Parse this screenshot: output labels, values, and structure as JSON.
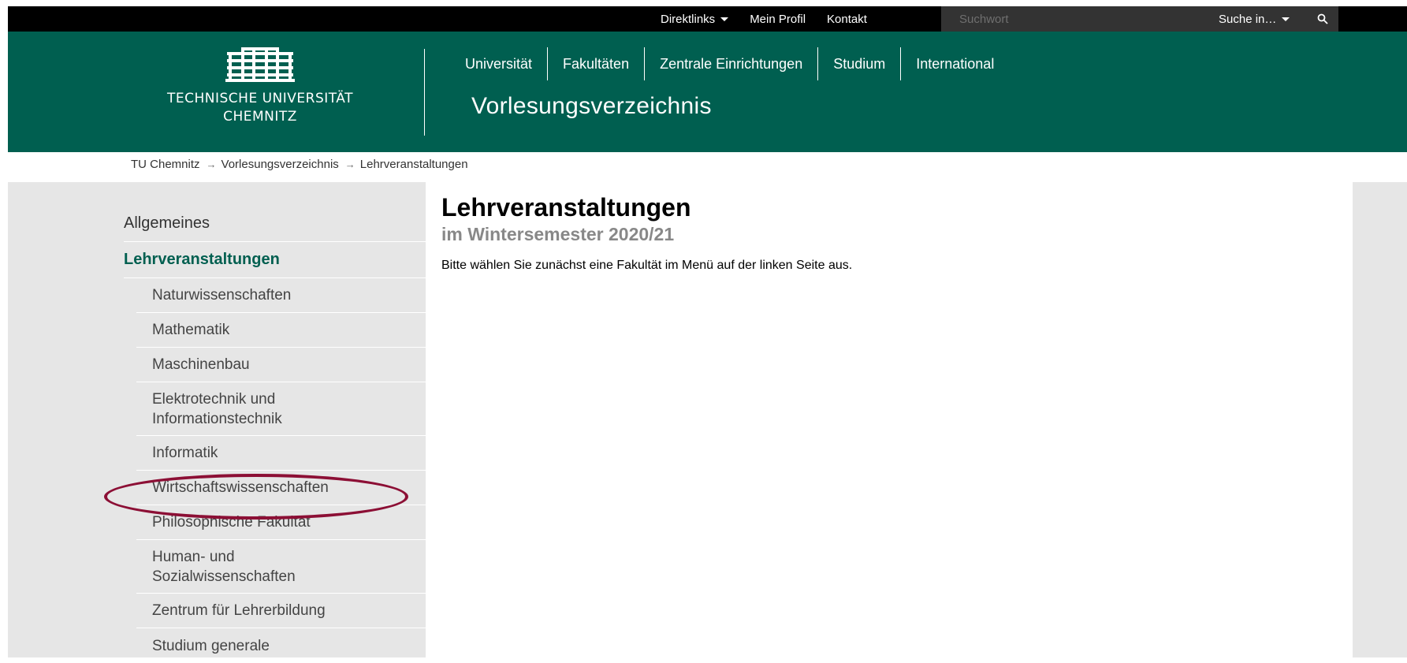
{
  "topbar": {
    "direktlinks": "Direktlinks",
    "profile": "Mein Profil",
    "contact": "Kontakt",
    "search_placeholder": "Suchwort",
    "search_in": "Suche in…"
  },
  "header": {
    "logo_line1": "TECHNISCHE UNIVERSITÄT",
    "logo_line2": "CHEMNITZ",
    "nav": [
      "Universität",
      "Fakultäten",
      "Zentrale Einrichtungen",
      "Studium",
      "International"
    ],
    "site_title": "Vorlesungsverzeichnis"
  },
  "breadcrumb": [
    "TU Chemnitz",
    "Vorlesungsverzeichnis",
    "Lehrveranstaltungen"
  ],
  "breadcrumb_sep": "→",
  "sidebar": {
    "general": "Allgemeines",
    "active": "Lehrveranstaltungen",
    "items": [
      "Naturwissenschaften",
      "Mathematik",
      "Maschinenbau",
      "Elektrotechnik und Informationstechnik",
      "Informatik",
      "Wirtschaftswissenschaften",
      "Philosophische Fakultät",
      "Human- und Sozialwissenschaften",
      "Zentrum für Lehrerbildung",
      "Studium generale"
    ]
  },
  "content": {
    "title": "Lehrveranstaltungen",
    "subtitle": "im Wintersemester 2020/21",
    "text": "Bitte wählen Sie zunächst eine Fakultät im Menü auf der linken Seite aus."
  },
  "colors": {
    "brand_green": "#005f50",
    "annotation": "#8c0f35"
  }
}
